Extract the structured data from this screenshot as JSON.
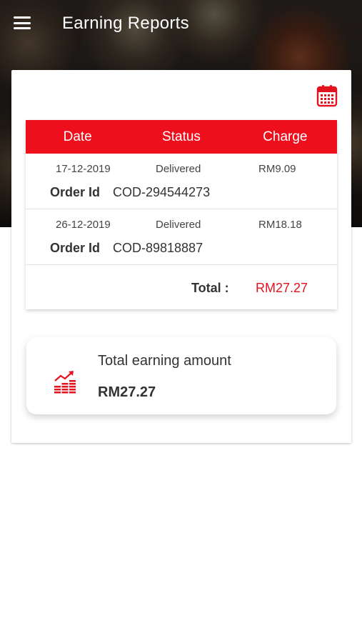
{
  "header": {
    "title": "Earning Reports",
    "menu_icon": "hamburger-menu-icon",
    "calendar_icon": "calendar-icon"
  },
  "colors": {
    "accent": "#ee0f1c",
    "total_value": "#e2131f"
  },
  "table": {
    "columns": [
      "Date",
      "Status",
      "Charge"
    ],
    "order_id_label": "Order Id",
    "rows": [
      {
        "date": "17-12-2019",
        "status": "Delivered",
        "charge": "RM9.09",
        "order_id": "COD-294544273"
      },
      {
        "date": "26-12-2019",
        "status": "Delivered",
        "charge": "RM18.18",
        "order_id": "COD-89818887"
      }
    ],
    "total_label": "Total :",
    "total_value": "RM27.27"
  },
  "summary": {
    "icon": "earnings-chart-icon",
    "title": "Total earning amount",
    "amount": "RM27.27"
  }
}
